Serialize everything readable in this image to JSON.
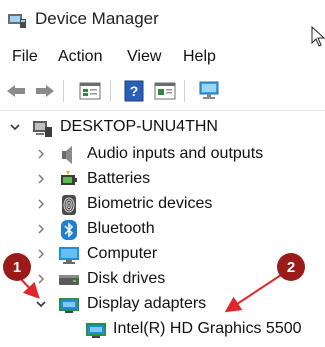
{
  "window": {
    "title": "Device Manager"
  },
  "menu": {
    "file": "File",
    "action": "Action",
    "view": "View",
    "help": "Help"
  },
  "toolbar": {
    "buttons": [
      "back-arrow-icon",
      "forward-arrow-icon",
      "properties-icon",
      "help-icon",
      "update-driver-icon",
      "scan-hardware-icon"
    ]
  },
  "tree": {
    "root": "DESKTOP-UNU4THN",
    "items": [
      {
        "label": "Audio inputs and outputs",
        "icon": "speaker-icon"
      },
      {
        "label": "Batteries",
        "icon": "battery-icon"
      },
      {
        "label": "Biometric devices",
        "icon": "fingerprint-icon"
      },
      {
        "label": "Bluetooth",
        "icon": "bluetooth-icon"
      },
      {
        "label": "Computer",
        "icon": "monitor-icon"
      },
      {
        "label": "Disk drives",
        "icon": "disk-icon"
      },
      {
        "label": "Display adapters",
        "icon": "display-adapter-icon",
        "expanded": true
      },
      {
        "label": "Intel(R) HD Graphics 5500",
        "icon": "display-adapter-icon",
        "child": true
      }
    ]
  },
  "annotations": {
    "badge1": "1",
    "badge2": "2"
  },
  "colors": {
    "badge": "#9b1a1a",
    "arrow": "#e0262a",
    "accent_blue": "#1e7fd0"
  }
}
